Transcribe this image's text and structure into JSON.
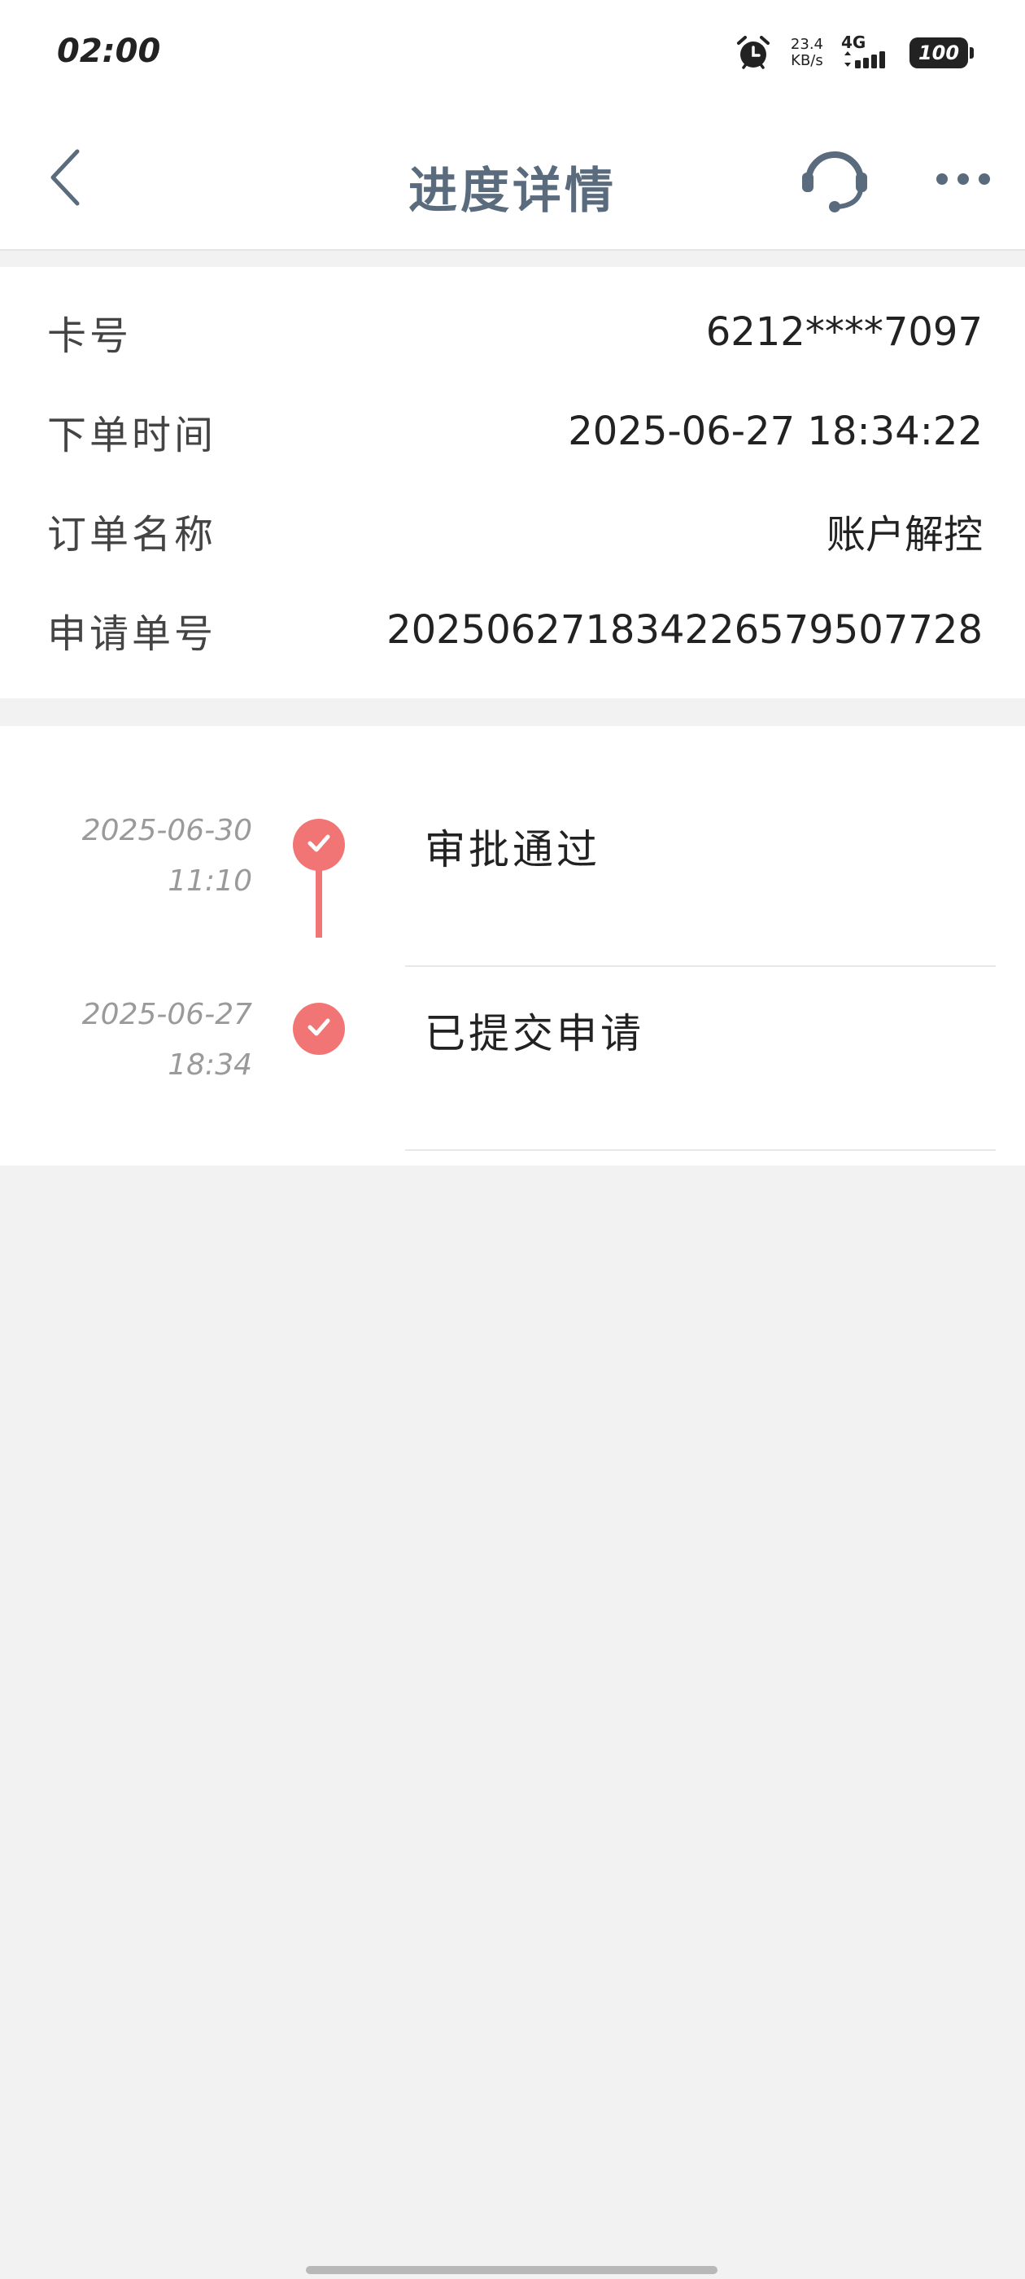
{
  "status_bar": {
    "time": "02:00",
    "net_speed_value": "23.4",
    "net_speed_unit": "KB/s",
    "network": "4G",
    "battery": "100"
  },
  "nav": {
    "title": "进度详情"
  },
  "info": {
    "rows": [
      {
        "label": "卡号",
        "value": "6212****7097"
      },
      {
        "label": "下单时间",
        "value": "2025-06-27 18:34:22"
      },
      {
        "label": "订单名称",
        "value": "账户解控"
      },
      {
        "label": "申请单号",
        "value": "20250627183422657950772​8"
      }
    ]
  },
  "timeline": {
    "accent_color": "#f27575",
    "items": [
      {
        "date": "2025-06-30",
        "time": "11:10",
        "title": "审批通过"
      },
      {
        "date": "2025-06-27",
        "time": "18:34",
        "title": "已提交申请"
      }
    ]
  }
}
